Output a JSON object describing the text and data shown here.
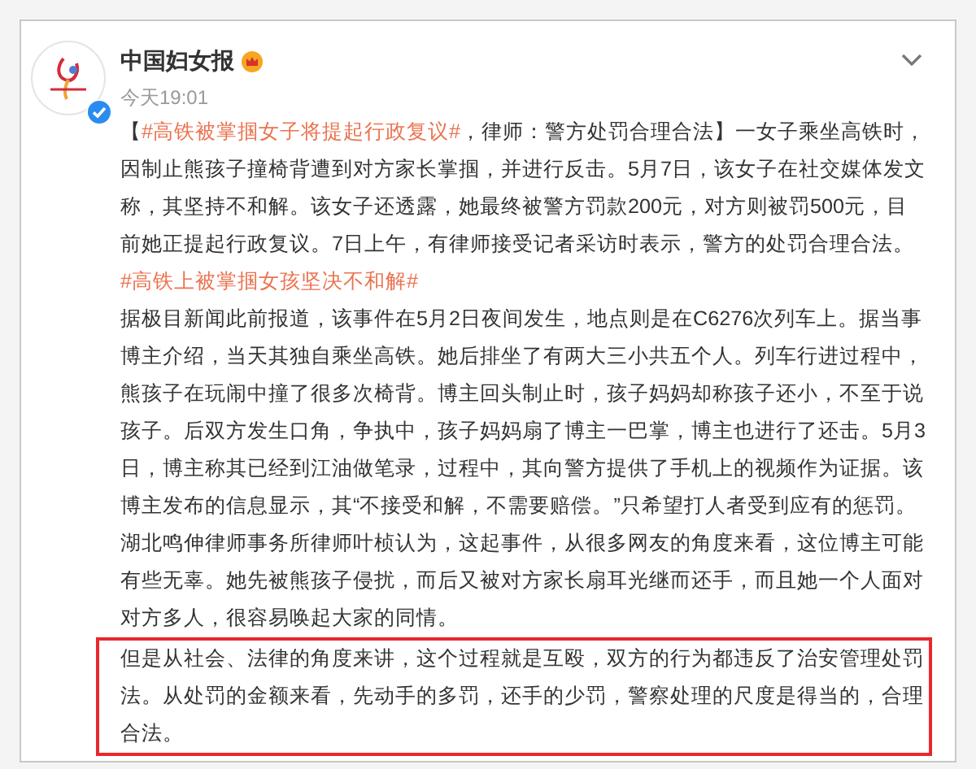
{
  "post": {
    "author": "中国妇女报",
    "verified": true,
    "time": "今天19:01",
    "paragraphs": [
      {
        "highlighted": false,
        "segments": [
          {
            "kind": "text",
            "text": "【"
          },
          {
            "kind": "hashtag",
            "text": "#高铁被掌掴女子将提起行政复议#"
          },
          {
            "kind": "text",
            "text": "，律师：警方处罚合理合法】一女子乘坐高铁时，因制止熊孩子撞椅背遭到对方家长掌掴，并进行反击。5月7日，该女子在社交媒体发文称，其坚持不和解。该女子还透露，她最终被警方罚款200元，对方则被罚500元，目前她正提起行政复议。7日上午，有律师接受记者采访时表示，警方的处罚合理合法。"
          },
          {
            "kind": "hashtag",
            "text": "#高铁上被掌掴女孩坚决不和解#"
          }
        ]
      },
      {
        "highlighted": false,
        "segments": [
          {
            "kind": "text",
            "text": "据极目新闻此前报道，该事件在5月2日夜间发生，地点则是在C6276次列车上。据当事博主介绍，当天其独自乘坐高铁。她后排坐了有两大三小共五个人。列车行进过程中，熊孩子在玩闹中撞了很多次椅背。博主回头制止时，孩子妈妈却称孩子还小，不至于说孩子。后双方发生口角，争执中，孩子妈妈扇了博主一巴掌，博主也进行了还击。5月3日，博主称其已经到江油做笔录，过程中，其向警方提供了手机上的视频作为证据。该博主发布的信息显示，其“不接受和解，不需要赔偿。”只希望打人者受到应有的惩罚。"
          }
        ]
      },
      {
        "highlighted": false,
        "segments": [
          {
            "kind": "text",
            "text": "湖北鸣伸律师事务所律师叶桢认为，这起事件，从很多网友的角度来看，这位博主可能有些无辜。她先被熊孩子侵扰，而后又被对方家长扇耳光继而还手，而且她一个人面对对方多人，很容易唤起大家的同情。"
          }
        ]
      },
      {
        "highlighted": true,
        "segments": [
          {
            "kind": "text",
            "text": "但是从社会、法律的角度来讲，这个过程就是互殴，双方的行为都违反了治安管理处罚法。从处罚的金额来看，先动手的多罚，还手的少罚，警察处理的尺度是得当的，合理合法。"
          }
        ]
      }
    ]
  }
}
